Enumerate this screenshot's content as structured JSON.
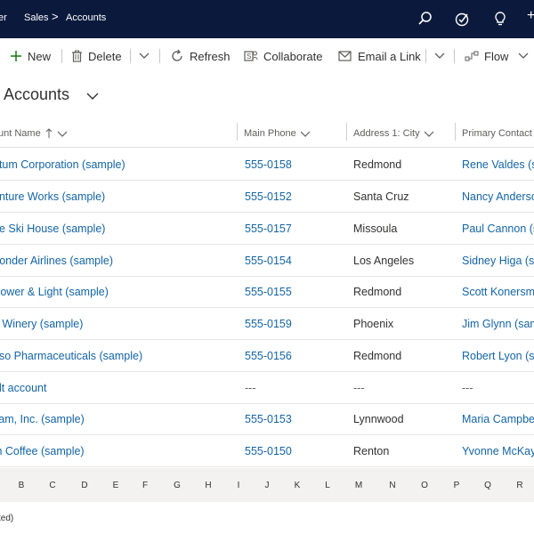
{
  "topbar": {
    "app_fragment": "er",
    "breadcrumb": [
      "Sales",
      "Accounts"
    ],
    "separator": ">",
    "plus_fragment": "+"
  },
  "commands": {
    "new": "New",
    "delete": "Delete",
    "refresh": "Refresh",
    "collaborate": "Collaborate",
    "email_link": "Email a Link",
    "flow": "Flow"
  },
  "view": {
    "title": "e Accounts"
  },
  "columns": {
    "name": "unt Name",
    "phone": "Main Phone",
    "city": "Address 1: City",
    "contact": "Primary Contact"
  },
  "rows": [
    {
      "name": "atum Corporation (sample)",
      "phone": "555-0158",
      "city": "Redmond",
      "contact": "Rene Valdes (sa"
    },
    {
      "name": "enture Works (sample)",
      "phone": "555-0152",
      "city": "Santa Cruz",
      "contact": "Nancy Anderso"
    },
    {
      "name": "ne Ski House (sample)",
      "phone": "555-0157",
      "city": "Missoula",
      "contact": "Paul Cannon (sa"
    },
    {
      "name": "Yonder Airlines (sample)",
      "phone": "555-0154",
      "city": "Los Angeles",
      "contact": "Sidney Higa (sa"
    },
    {
      "name": "Power & Light (sample)",
      "phone": "555-0155",
      "city": "Redmond",
      "contact": "Scott Konersm"
    },
    {
      "name": "o Winery (sample)",
      "phone": "555-0159",
      "city": "Phoenix",
      "contact": "Jim Glynn (sam"
    },
    {
      "name": "oso Pharmaceuticals (sample)",
      "phone": "555-0156",
      "city": "Redmond",
      "contact": "Robert Lyon (sa"
    },
    {
      "name": "ult account",
      "phone": "---",
      "city": "---",
      "contact": "---"
    },
    {
      "name": "kam, Inc. (sample)",
      "phone": "555-0153",
      "city": "Lynnwood",
      "contact": "Maria Campbe"
    },
    {
      "name": "th Coffee (sample)",
      "phone": "555-0150",
      "city": "Renton",
      "contact": "Yvonne McKay"
    }
  ],
  "jump_letters": [
    "B",
    "C",
    "D",
    "E",
    "F",
    "G",
    "H",
    "I",
    "J",
    "K",
    "L",
    "M",
    "N",
    "O",
    "P",
    "Q",
    "R"
  ],
  "status": "ted)"
}
